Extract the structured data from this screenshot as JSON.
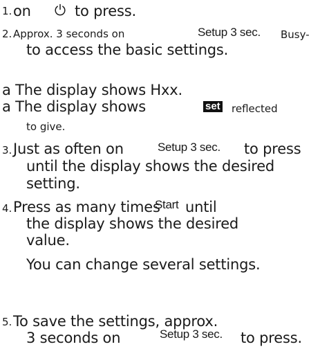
{
  "step1": {
    "num": "1.",
    "pre": "on",
    "icon": "power-icon",
    "post": "to press."
  },
  "step2": {
    "num": "2.",
    "pre": "Approx. 3 seconds on",
    "label": "Setup 3 sec.",
    "tail": "Busy-",
    "line2": "to access the basic settings."
  },
  "note1": "a The display shows Hxx.",
  "note2": {
    "pre": "a The display shows",
    "badge": "set",
    "post": "reflected",
    "line2": "to give."
  },
  "step3": {
    "num": "3.",
    "pre": "Just as often on",
    "label": "Setup 3 sec.",
    "post": "to press",
    "line2": "until the display shows the desired",
    "line3": "setting."
  },
  "step4": {
    "num": "4.",
    "pre": "Press as many times",
    "label": "Start",
    "post": "until",
    "line2": "the display shows the desired",
    "line3": "value.",
    "line4": "You can change several settings."
  },
  "step5": {
    "num": "5.",
    "pre": "To save the settings, approx.",
    "line2": "3 seconds on",
    "label": "Setup 3 sec.",
    "post": "to press."
  }
}
